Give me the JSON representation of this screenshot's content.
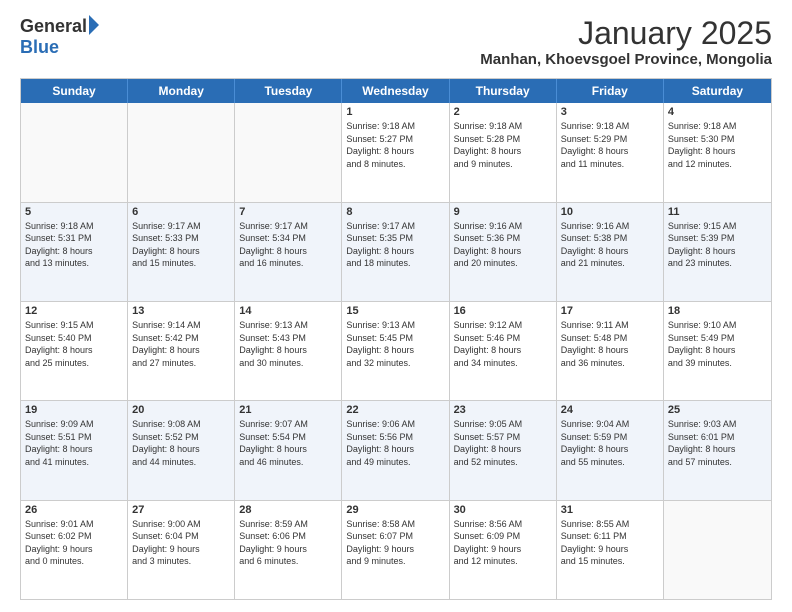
{
  "logo": {
    "general": "General",
    "blue": "Blue"
  },
  "header": {
    "month": "January 2025",
    "location": "Manhan, Khoevsgoel Province, Mongolia"
  },
  "weekdays": [
    "Sunday",
    "Monday",
    "Tuesday",
    "Wednesday",
    "Thursday",
    "Friday",
    "Saturday"
  ],
  "rows": [
    [
      {
        "day": "",
        "info": ""
      },
      {
        "day": "",
        "info": ""
      },
      {
        "day": "",
        "info": ""
      },
      {
        "day": "1",
        "info": "Sunrise: 9:18 AM\nSunset: 5:27 PM\nDaylight: 8 hours\nand 8 minutes."
      },
      {
        "day": "2",
        "info": "Sunrise: 9:18 AM\nSunset: 5:28 PM\nDaylight: 8 hours\nand 9 minutes."
      },
      {
        "day": "3",
        "info": "Sunrise: 9:18 AM\nSunset: 5:29 PM\nDaylight: 8 hours\nand 11 minutes."
      },
      {
        "day": "4",
        "info": "Sunrise: 9:18 AM\nSunset: 5:30 PM\nDaylight: 8 hours\nand 12 minutes."
      }
    ],
    [
      {
        "day": "5",
        "info": "Sunrise: 9:18 AM\nSunset: 5:31 PM\nDaylight: 8 hours\nand 13 minutes."
      },
      {
        "day": "6",
        "info": "Sunrise: 9:17 AM\nSunset: 5:33 PM\nDaylight: 8 hours\nand 15 minutes."
      },
      {
        "day": "7",
        "info": "Sunrise: 9:17 AM\nSunset: 5:34 PM\nDaylight: 8 hours\nand 16 minutes."
      },
      {
        "day": "8",
        "info": "Sunrise: 9:17 AM\nSunset: 5:35 PM\nDaylight: 8 hours\nand 18 minutes."
      },
      {
        "day": "9",
        "info": "Sunrise: 9:16 AM\nSunset: 5:36 PM\nDaylight: 8 hours\nand 20 minutes."
      },
      {
        "day": "10",
        "info": "Sunrise: 9:16 AM\nSunset: 5:38 PM\nDaylight: 8 hours\nand 21 minutes."
      },
      {
        "day": "11",
        "info": "Sunrise: 9:15 AM\nSunset: 5:39 PM\nDaylight: 8 hours\nand 23 minutes."
      }
    ],
    [
      {
        "day": "12",
        "info": "Sunrise: 9:15 AM\nSunset: 5:40 PM\nDaylight: 8 hours\nand 25 minutes."
      },
      {
        "day": "13",
        "info": "Sunrise: 9:14 AM\nSunset: 5:42 PM\nDaylight: 8 hours\nand 27 minutes."
      },
      {
        "day": "14",
        "info": "Sunrise: 9:13 AM\nSunset: 5:43 PM\nDaylight: 8 hours\nand 30 minutes."
      },
      {
        "day": "15",
        "info": "Sunrise: 9:13 AM\nSunset: 5:45 PM\nDaylight: 8 hours\nand 32 minutes."
      },
      {
        "day": "16",
        "info": "Sunrise: 9:12 AM\nSunset: 5:46 PM\nDaylight: 8 hours\nand 34 minutes."
      },
      {
        "day": "17",
        "info": "Sunrise: 9:11 AM\nSunset: 5:48 PM\nDaylight: 8 hours\nand 36 minutes."
      },
      {
        "day": "18",
        "info": "Sunrise: 9:10 AM\nSunset: 5:49 PM\nDaylight: 8 hours\nand 39 minutes."
      }
    ],
    [
      {
        "day": "19",
        "info": "Sunrise: 9:09 AM\nSunset: 5:51 PM\nDaylight: 8 hours\nand 41 minutes."
      },
      {
        "day": "20",
        "info": "Sunrise: 9:08 AM\nSunset: 5:52 PM\nDaylight: 8 hours\nand 44 minutes."
      },
      {
        "day": "21",
        "info": "Sunrise: 9:07 AM\nSunset: 5:54 PM\nDaylight: 8 hours\nand 46 minutes."
      },
      {
        "day": "22",
        "info": "Sunrise: 9:06 AM\nSunset: 5:56 PM\nDaylight: 8 hours\nand 49 minutes."
      },
      {
        "day": "23",
        "info": "Sunrise: 9:05 AM\nSunset: 5:57 PM\nDaylight: 8 hours\nand 52 minutes."
      },
      {
        "day": "24",
        "info": "Sunrise: 9:04 AM\nSunset: 5:59 PM\nDaylight: 8 hours\nand 55 minutes."
      },
      {
        "day": "25",
        "info": "Sunrise: 9:03 AM\nSunset: 6:01 PM\nDaylight: 8 hours\nand 57 minutes."
      }
    ],
    [
      {
        "day": "26",
        "info": "Sunrise: 9:01 AM\nSunset: 6:02 PM\nDaylight: 9 hours\nand 0 minutes."
      },
      {
        "day": "27",
        "info": "Sunrise: 9:00 AM\nSunset: 6:04 PM\nDaylight: 9 hours\nand 3 minutes."
      },
      {
        "day": "28",
        "info": "Sunrise: 8:59 AM\nSunset: 6:06 PM\nDaylight: 9 hours\nand 6 minutes."
      },
      {
        "day": "29",
        "info": "Sunrise: 8:58 AM\nSunset: 6:07 PM\nDaylight: 9 hours\nand 9 minutes."
      },
      {
        "day": "30",
        "info": "Sunrise: 8:56 AM\nSunset: 6:09 PM\nDaylight: 9 hours\nand 12 minutes."
      },
      {
        "day": "31",
        "info": "Sunrise: 8:55 AM\nSunset: 6:11 PM\nDaylight: 9 hours\nand 15 minutes."
      },
      {
        "day": "",
        "info": ""
      }
    ]
  ]
}
